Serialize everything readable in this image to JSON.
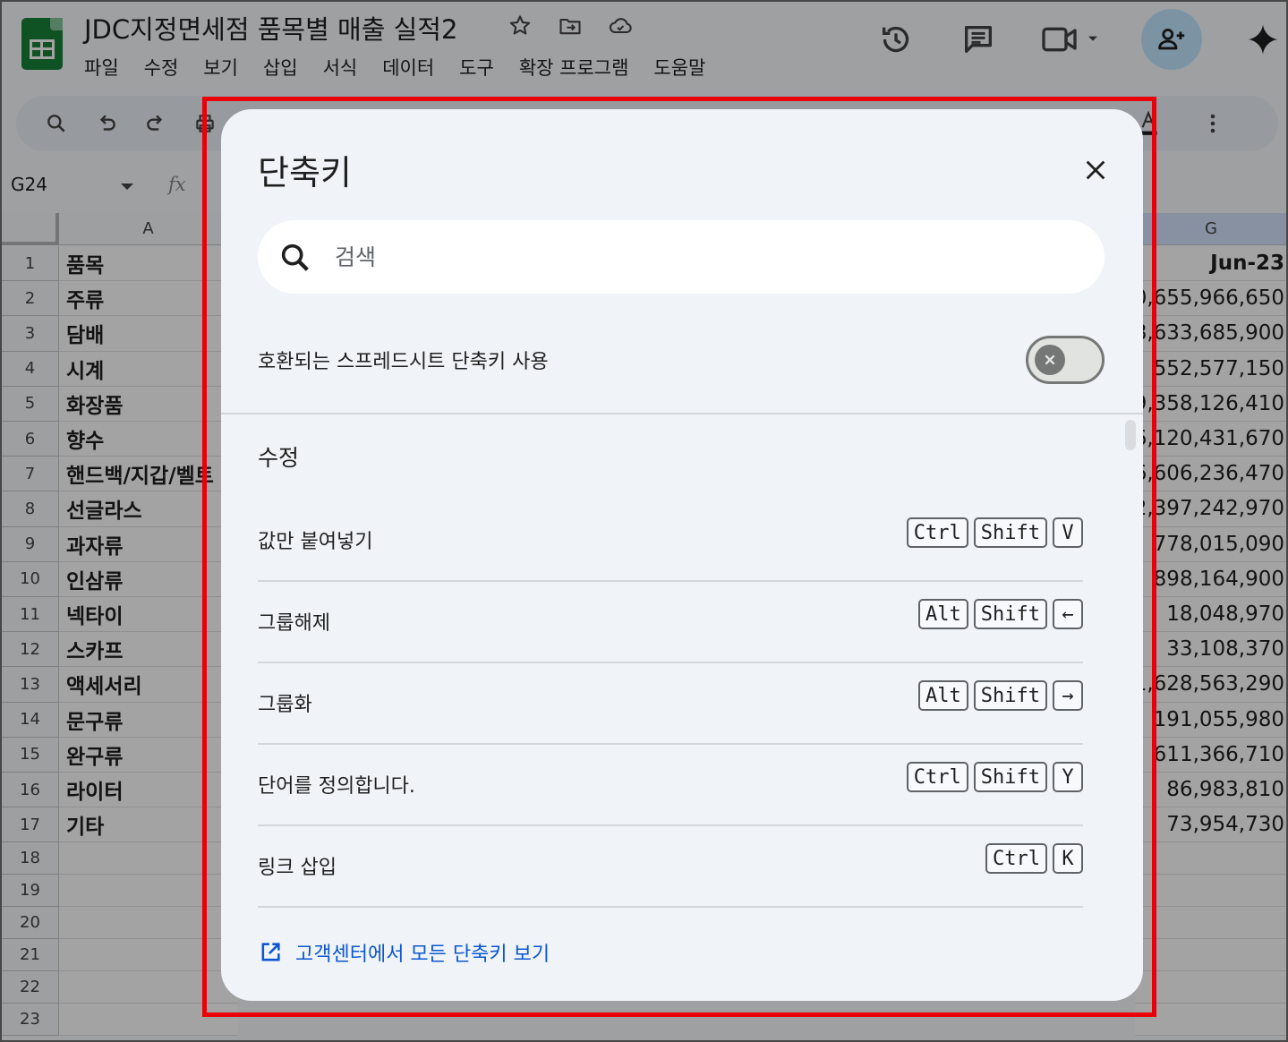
{
  "app": {
    "document_title": "JDC지정면세점 품목별 매출 실적2",
    "menu": [
      "파일",
      "수정",
      "보기",
      "삽입",
      "서식",
      "데이터",
      "도구",
      "확장 프로그램",
      "도움말"
    ],
    "name_box": "G24",
    "formula_icon": "fx",
    "columns": {
      "a": "A",
      "g": "G"
    },
    "rows": [
      {
        "num": "1",
        "a": "품목",
        "g": "Jun-23"
      },
      {
        "num": "2",
        "a": "주류",
        "g": "0,655,966,650"
      },
      {
        "num": "3",
        "a": "담배",
        "g": "8,633,685,900"
      },
      {
        "num": "4",
        "a": "시계",
        "g": "552,577,150"
      },
      {
        "num": "5",
        "a": "화장품",
        "g": "9,358,126,410"
      },
      {
        "num": "6",
        "a": "향수",
        "g": "6,120,431,670"
      },
      {
        "num": "7",
        "a": "핸드백/지갑/벨트",
        "g": "6,606,236,470"
      },
      {
        "num": "8",
        "a": "선글라스",
        "g": "2,397,242,970"
      },
      {
        "num": "9",
        "a": "과자류",
        "g": "778,015,090"
      },
      {
        "num": "10",
        "a": "인삼류",
        "g": "898,164,900"
      },
      {
        "num": "11",
        "a": "넥타이",
        "g": "18,048,970"
      },
      {
        "num": "12",
        "a": "스카프",
        "g": "33,108,370"
      },
      {
        "num": "13",
        "a": "액세서리",
        "g": "1,628,563,290"
      },
      {
        "num": "14",
        "a": "문구류",
        "g": "191,055,980"
      },
      {
        "num": "15",
        "a": "완구류",
        "g": "611,366,710"
      },
      {
        "num": "16",
        "a": "라이터",
        "g": "86,983,810"
      },
      {
        "num": "17",
        "a": "기타",
        "g": "73,954,730"
      },
      {
        "num": "18",
        "a": "",
        "g": ""
      },
      {
        "num": "19",
        "a": "",
        "g": ""
      },
      {
        "num": "20",
        "a": "",
        "g": ""
      },
      {
        "num": "21",
        "a": "",
        "g": ""
      },
      {
        "num": "22",
        "a": "",
        "g": ""
      },
      {
        "num": "23",
        "a": "",
        "g": ""
      }
    ],
    "colors": {
      "sheets_green": "#188038",
      "share_bg": "#c2e7ff",
      "highlight_red": "#e8000b"
    }
  },
  "dialog": {
    "title": "단축키",
    "search_placeholder": "검색",
    "compat_label": "호환되는 스프레드시트 단축키 사용",
    "compat_enabled": false,
    "section_title": "수정",
    "shortcuts": [
      {
        "label": "값만 붙여넣기",
        "keys": [
          "Ctrl",
          "Shift",
          "V"
        ]
      },
      {
        "label": "그룹해제",
        "keys": [
          "Alt",
          "Shift",
          "←"
        ]
      },
      {
        "label": "그룹화",
        "keys": [
          "Alt",
          "Shift",
          "→"
        ]
      },
      {
        "label": "단어를 정의합니다.",
        "keys": [
          "Ctrl",
          "Shift",
          "Y"
        ]
      },
      {
        "label": "링크 삽입",
        "keys": [
          "Ctrl",
          "K"
        ]
      }
    ],
    "help_link": "고객센터에서 모든 단축키 보기",
    "link_color": "#0b57d0"
  }
}
